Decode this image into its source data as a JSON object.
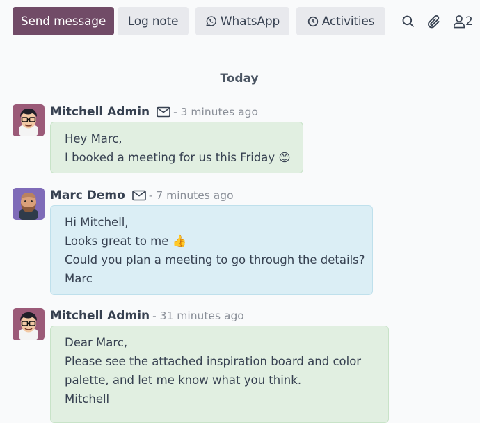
{
  "toolbar": {
    "send_message": "Send message",
    "log_note": "Log note",
    "whatsapp": "WhatsApp",
    "activities": "Activities",
    "followers_count": "2",
    "icons": [
      "search-icon",
      "paperclip-icon",
      "user-icon",
      "whatsapp-icon",
      "clock-icon"
    ]
  },
  "divider": {
    "label": "Today"
  },
  "messages": [
    {
      "author": "Mitchell Admin",
      "time": "- 3 minutes ago",
      "has_envelope": true,
      "bubble_color": "green",
      "lines": [
        "Hey Marc,",
        "I booked a meeting for us this Friday 😊"
      ]
    },
    {
      "author": "Marc Demo",
      "time": "- 7 minutes ago",
      "has_envelope": true,
      "bubble_color": "blue",
      "lines": [
        "Hi Mitchell,",
        "Looks great to me 👍",
        "Could you plan a meeting to go through the details?",
        "Marc"
      ]
    },
    {
      "author": "Mitchell Admin",
      "time": "- 31 minutes ago",
      "has_envelope": false,
      "bubble_color": "green",
      "lines": [
        "Dear Marc,",
        "Please see the attached inspiration board and color",
        "palette, and let me know what you think.",
        "Mitchell"
      ]
    }
  ],
  "colors": {
    "primary": "#714b67",
    "secondary_button": "#e8e9ed",
    "bubble_green": "#e1efe1",
    "bubble_blue": "#dbeef5",
    "timestamp": "#8a8f98"
  }
}
